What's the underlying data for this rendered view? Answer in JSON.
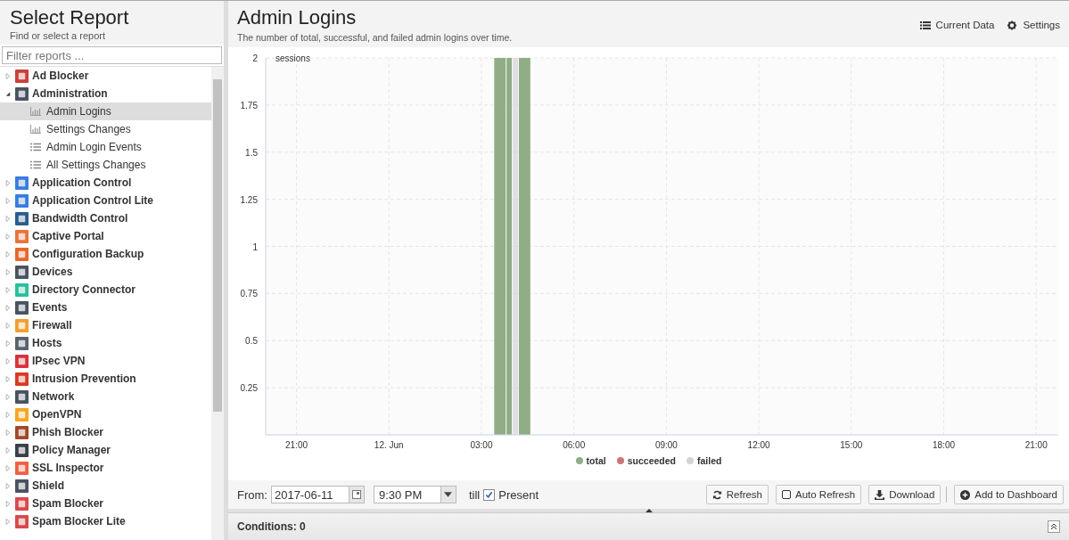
{
  "sidebar": {
    "title": "Select Report",
    "subtitle": "Find or select a report",
    "filter": {
      "placeholder": "Filter reports ..."
    },
    "items": [
      {
        "label": "Ad Blocker",
        "color": "#c9403a",
        "expanded": false
      },
      {
        "label": "Administration",
        "color": "#4a5260",
        "expanded": true,
        "children": [
          {
            "label": "Admin Logins",
            "kind": "chart",
            "selected": true
          },
          {
            "label": "Settings Changes",
            "kind": "chart",
            "selected": false
          },
          {
            "label": "Admin Login Events",
            "kind": "list",
            "selected": false
          },
          {
            "label": "All Settings Changes",
            "kind": "list",
            "selected": false
          }
        ]
      },
      {
        "label": "Application Control",
        "color": "#3b7ddd",
        "expanded": false
      },
      {
        "label": "Application Control Lite",
        "color": "#3b7ddd",
        "expanded": false
      },
      {
        "label": "Bandwidth Control",
        "color": "#2a5d8a",
        "expanded": false
      },
      {
        "label": "Captive Portal",
        "color": "#e8733a",
        "expanded": false
      },
      {
        "label": "Configuration Backup",
        "color": "#e8672a",
        "expanded": false
      },
      {
        "label": "Devices",
        "color": "#4a5260",
        "expanded": false
      },
      {
        "label": "Directory Connector",
        "color": "#2bbf9e",
        "expanded": false
      },
      {
        "label": "Events",
        "color": "#4a5260",
        "expanded": false
      },
      {
        "label": "Firewall",
        "color": "#f0a030",
        "expanded": false
      },
      {
        "label": "Hosts",
        "color": "#5a6270",
        "expanded": false
      },
      {
        "label": "IPsec VPN",
        "color": "#d8333a",
        "expanded": false
      },
      {
        "label": "Intrusion Prevention",
        "color": "#d83a22",
        "expanded": false
      },
      {
        "label": "Network",
        "color": "#4a5260",
        "expanded": false
      },
      {
        "label": "OpenVPN",
        "color": "#f5a623",
        "expanded": false
      },
      {
        "label": "Phish Blocker",
        "color": "#a04a2a",
        "expanded": false
      },
      {
        "label": "Policy Manager",
        "color": "#3a3f48",
        "expanded": false
      },
      {
        "label": "SSL Inspector",
        "color": "#f06040",
        "expanded": false
      },
      {
        "label": "Shield",
        "color": "#4a5260",
        "expanded": false
      },
      {
        "label": "Spam Blocker",
        "color": "#d84a4a",
        "expanded": false
      },
      {
        "label": "Spam Blocker Lite",
        "color": "#d84a4a",
        "expanded": false
      }
    ]
  },
  "report": {
    "title": "Admin Logins",
    "description": "The number of total, successful, and failed admin logins over time.",
    "actions": [
      {
        "label": "Current Data",
        "kind": "list"
      },
      {
        "label": "Settings",
        "kind": "gear"
      }
    ],
    "chart_data": {
      "type": "bar",
      "grid": true,
      "ylabel": "sessions",
      "x": [
        "2017-06-12 03:36",
        "2017-06-12 04:00",
        "2017-06-12 04:24"
      ],
      "xlim": [
        "2017-06-11 20:00",
        "2017-06-12 21:43"
      ],
      "ylim": [
        0,
        2
      ],
      "xticks": [
        {
          "value": "2017-06-11 21:00",
          "label": "21:00"
        },
        {
          "value": "2017-06-12 00:00",
          "label": "12. Jun"
        },
        {
          "value": "2017-06-12 03:00",
          "label": "03:00"
        },
        {
          "value": "2017-06-12 06:00",
          "label": "06:00"
        },
        {
          "value": "2017-06-12 09:00",
          "label": "09:00"
        },
        {
          "value": "2017-06-12 12:00",
          "label": "12:00"
        },
        {
          "value": "2017-06-12 15:00",
          "label": "15:00"
        },
        {
          "value": "2017-06-12 18:00",
          "label": "18:00"
        },
        {
          "value": "2017-06-12 21:00",
          "label": "21:00"
        }
      ],
      "yticks": [
        0.25,
        0.5,
        0.75,
        1,
        1.25,
        1.5,
        1.75,
        2
      ],
      "series": [
        {
          "name": "total",
          "color": "#90ad86",
          "values": [
            2,
            2,
            2
          ]
        },
        {
          "name": "succeeded",
          "color": "#c97878",
          "values": [
            0,
            0,
            0
          ]
        },
        {
          "name": "failed",
          "color": "#d4d4d4",
          "values": [
            0,
            2,
            0
          ]
        }
      ]
    }
  },
  "toolbar": {
    "from_label": "From:",
    "date": "2017-06-11",
    "time": "9:30 PM",
    "till_label": "till",
    "present": {
      "label": "Present",
      "checked": true
    },
    "buttons": [
      {
        "label": "Refresh",
        "kind": "refresh"
      },
      {
        "label": "Auto Refresh",
        "kind": "checkbox"
      },
      {
        "label": "Download",
        "kind": "download"
      },
      {
        "label": "Add to Dashboard",
        "kind": "add"
      }
    ]
  },
  "conditions": {
    "label": "Conditions: 0"
  }
}
